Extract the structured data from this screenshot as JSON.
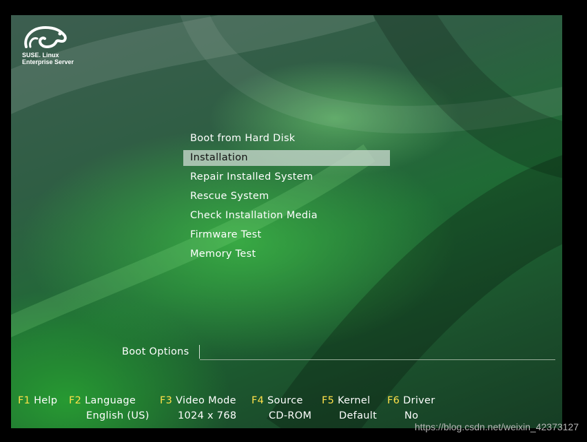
{
  "logo": {
    "line1": "SUSE. Linux",
    "line2": "Enterprise Server"
  },
  "menu": {
    "items": [
      {
        "label": "Boot from Hard Disk"
      },
      {
        "label": "Installation"
      },
      {
        "label": "Repair Installed System"
      },
      {
        "label": "Rescue System"
      },
      {
        "label": "Check Installation Media"
      },
      {
        "label": "Firmware Test"
      },
      {
        "label": "Memory Test"
      }
    ],
    "selected_label": "Installation"
  },
  "boot_options": {
    "label": "Boot Options",
    "value": ""
  },
  "function_keys": [
    {
      "key": "F1",
      "label": "Help",
      "value": ""
    },
    {
      "key": "F2",
      "label": "Language",
      "value": "English (US)"
    },
    {
      "key": "F3",
      "label": "Video Mode",
      "value": "1024 x 768"
    },
    {
      "key": "F4",
      "label": "Source",
      "value": "CD-ROM"
    },
    {
      "key": "F5",
      "label": "Kernel",
      "value": "Default"
    },
    {
      "key": "F6",
      "label": "Driver",
      "value": "No"
    }
  ],
  "watermark": "https://blog.csdn.net/weixin_42373127",
  "colors": {
    "fkey": "#ffe14a",
    "selection": "#c8d7cd",
    "background": "#2f5e44"
  }
}
